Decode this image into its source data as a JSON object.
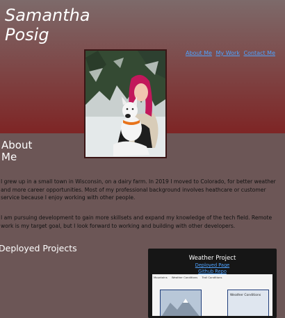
{
  "header": {
    "name_line1": "Samantha",
    "name_line2": "Posig",
    "nav": [
      "About Me",
      "My Work",
      "Contact Me"
    ]
  },
  "about": {
    "title_line1": "About",
    "title_line2": "Me",
    "paragraph1": "I grew up in a small town in Wisconsin, on a dairy farm. In 2019 I moved to Colorado, for better weather and more career opportunities. Most of my professional background involves heathcare or customer service because I enjoy working with other people.",
    "paragraph2": "I am pursuing development to gain more skillsets and expand my knowledge of the tech field. Remote work is my target goal, but I look forward to working and building with other developers."
  },
  "projects": {
    "title": "Deployed Projects",
    "cards": [
      {
        "title": "Weather Project",
        "link1": "Deployed Page",
        "link2": "Github Repo",
        "screenshot_tabs": [
          "Mountains",
          "Weather Conditions",
          "Trail Conditions"
        ],
        "screenshot_label": "Weather Conditions"
      }
    ]
  },
  "colors": {
    "background": "#6c5656",
    "header_top": "#7d6a6a",
    "header_bottom": "#7e2525",
    "link": "#4fa3ff",
    "card": "#161616"
  }
}
